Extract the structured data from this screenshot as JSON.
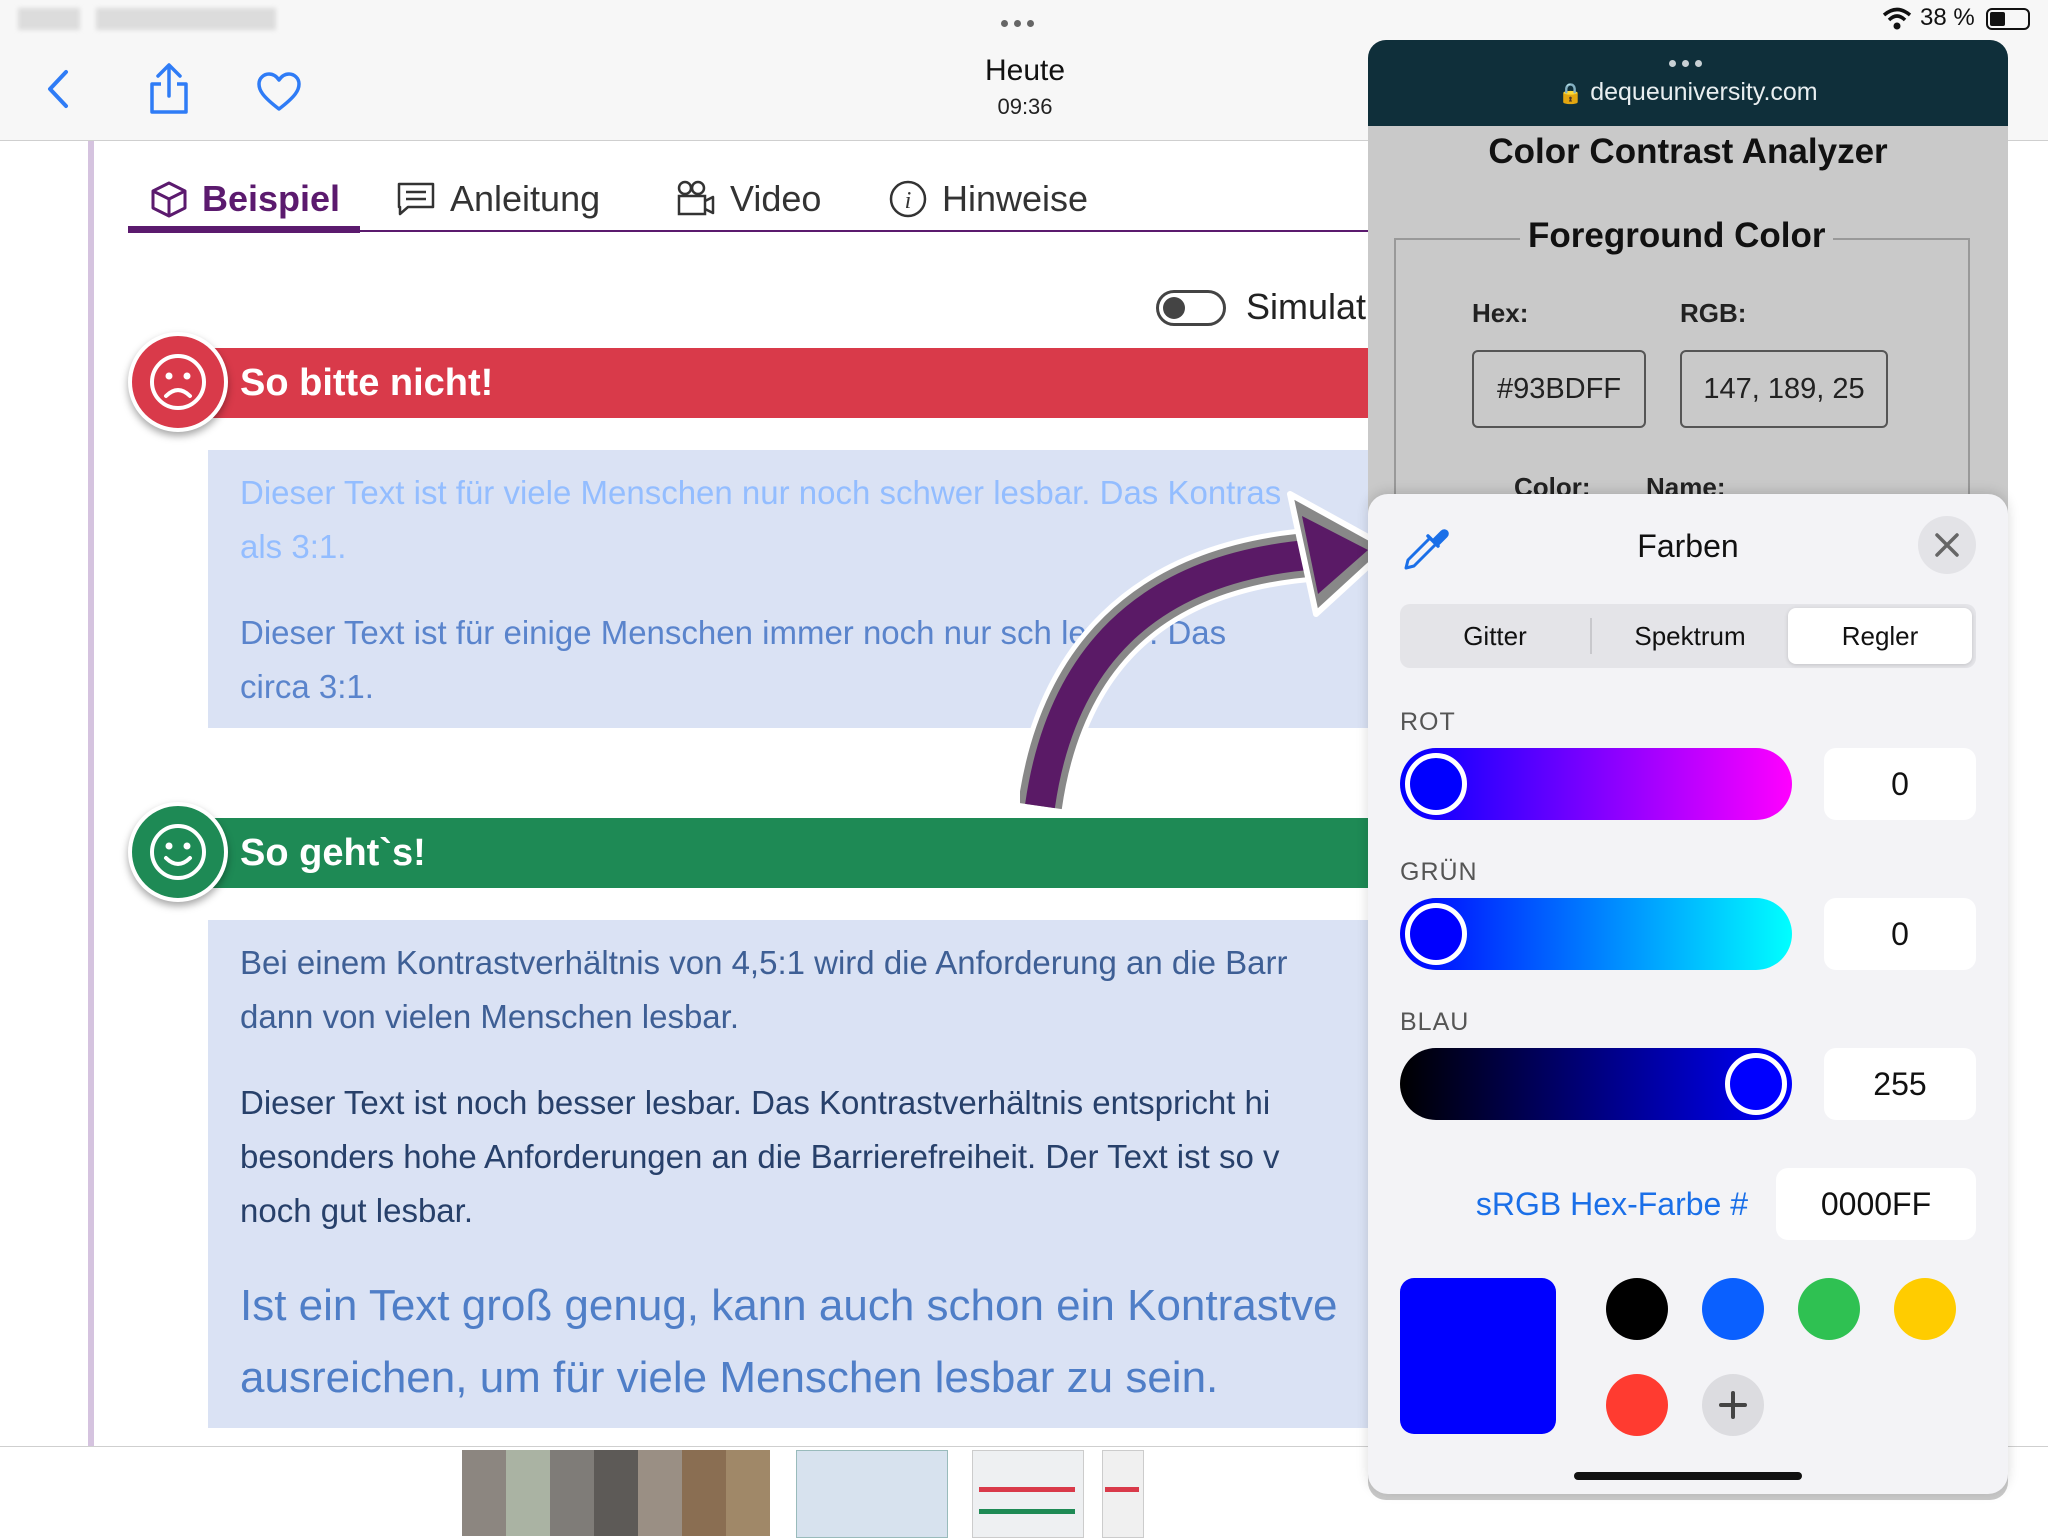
{
  "status_bar": {
    "wifi_icon": "wifi-icon",
    "battery_text": "38 %",
    "battery_icon": "battery-icon"
  },
  "nav": {
    "title": "Heute",
    "time": "09:36",
    "back_icon": "chevron-left-icon",
    "share_icon": "share-icon",
    "favorite_icon": "heart-icon"
  },
  "tabs": [
    {
      "label": "Beispiel",
      "icon": "cube-icon",
      "active": true
    },
    {
      "label": "Anleitung",
      "icon": "message-icon",
      "active": false
    },
    {
      "label": "Video",
      "icon": "video-camera-icon",
      "active": false
    },
    {
      "label": "Hinweise",
      "icon": "info-icon",
      "active": false
    }
  ],
  "simulation_label": "Simulat",
  "bad_example": {
    "banner": "So bitte nicht!",
    "icon": "sad-face-icon",
    "color": "#d93a4a",
    "para1_line1": "Dieser Text ist für viele Menschen nur noch schwer lesbar. Das Kontras",
    "para1_line2": "als 3:1.",
    "para2_line1": "Dieser Text ist für einige Menschen immer noch nur sch     lesbar. Das",
    "para2_line2": "circa 3:1."
  },
  "good_example": {
    "banner": "So geht`s!",
    "icon": "smiley-face-icon",
    "color": "#1e8a55",
    "para1_line1": "Bei einem Kontrastverhältnis von 4,5:1 wird die Anforderung an die Barr",
    "para1_line2": "dann von vielen Menschen lesbar.",
    "para2_line1": "Dieser Text ist noch besser lesbar. Das Kontrastverhältnis entspricht hi",
    "para2_line2": "besonders hohe Anforderungen an die Barrierefreiheit. Der Text ist so v",
    "para2_line3": "noch gut lesbar.",
    "para3_line1": "Ist ein Text groß genug, kann auch schon ein Kontrastve",
    "para3_line2": "ausreichen, um für viele Menschen lesbar zu sein."
  },
  "deque": {
    "url": "dequeuniversity.com",
    "title": "Color Contrast Analyzer",
    "section": "Foreground Color",
    "hex_label": "Hex:",
    "rgb_label": "RGB:",
    "hex_value": "#93BDFF",
    "rgb_value": "147, 189, 25",
    "color_label": "Color:",
    "name_label": "Name:"
  },
  "picker": {
    "title": "Farben",
    "eyedropper_icon": "eyedropper-icon",
    "close_icon": "close-icon",
    "segments": [
      "Gitter",
      "Spektrum",
      "Regler"
    ],
    "selected_segment": "Regler",
    "red_label": "ROT",
    "red_value": "0",
    "green_label": "GRÜN",
    "green_value": "0",
    "blue_label": "BLAU",
    "blue_value": "255",
    "hex_label": "sRGB Hex-Farbe #",
    "hex_value": "0000FF",
    "current_color": "#0000ff",
    "swatches": [
      "#000000",
      "#0a60ff",
      "#2fc152",
      "#ffcc00",
      "#ff3b30"
    ],
    "add_icon": "plus-icon"
  }
}
